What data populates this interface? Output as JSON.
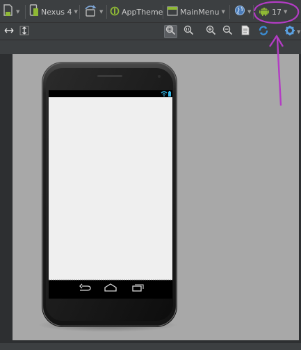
{
  "toolbar": {
    "device": "Nexus 4",
    "theme": "AppTheme",
    "activity": "MainMenu",
    "api_level": "17"
  },
  "icons": {
    "layout_variant": "layout-file-icon",
    "device": "device-icon",
    "orientation": "orientation-icon",
    "theme": "theme-icon",
    "activity": "activity-icon",
    "locale": "globe-icon",
    "api": "android-icon",
    "expand_h": "expand-horizontal-icon",
    "expand_v": "expand-vertical-icon",
    "zoom_to_fit": "zoom-to-fit-icon",
    "zoom_actual": "zoom-actual-size-icon",
    "zoom_in": "zoom-in-icon",
    "zoom_out": "zoom-out-icon",
    "preview": "preview-icon",
    "refresh": "refresh-icon",
    "settings": "gear-icon"
  },
  "colors": {
    "accent_android": "#8fb935",
    "refresh": "#3b8fd8",
    "annotation": "#b33cc4",
    "status_bar_icons": "#33b5e5",
    "canvas": "#a8a8a8"
  }
}
